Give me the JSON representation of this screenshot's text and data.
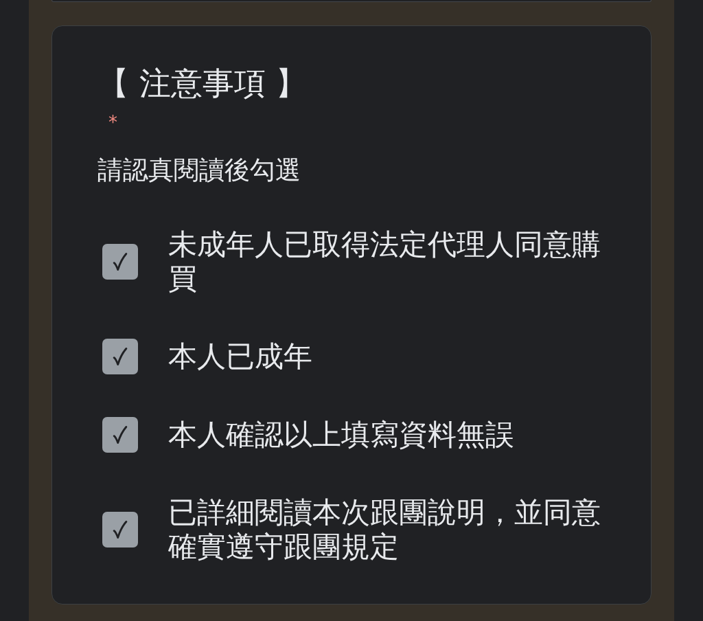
{
  "form_card": {
    "title": "【 注意事項 】",
    "required_mark": "*",
    "description": "請認真閱讀後勾選",
    "options": [
      {
        "label": "未成年人已取得法定代理人同意購買",
        "checked": true
      },
      {
        "label": "本人已成年",
        "checked": true
      },
      {
        "label": "本人確認以上填寫資料無誤",
        "checked": true
      },
      {
        "label": "已詳細閱讀本次跟團說明，並同意確實遵守跟團規定",
        "checked": true
      }
    ]
  }
}
